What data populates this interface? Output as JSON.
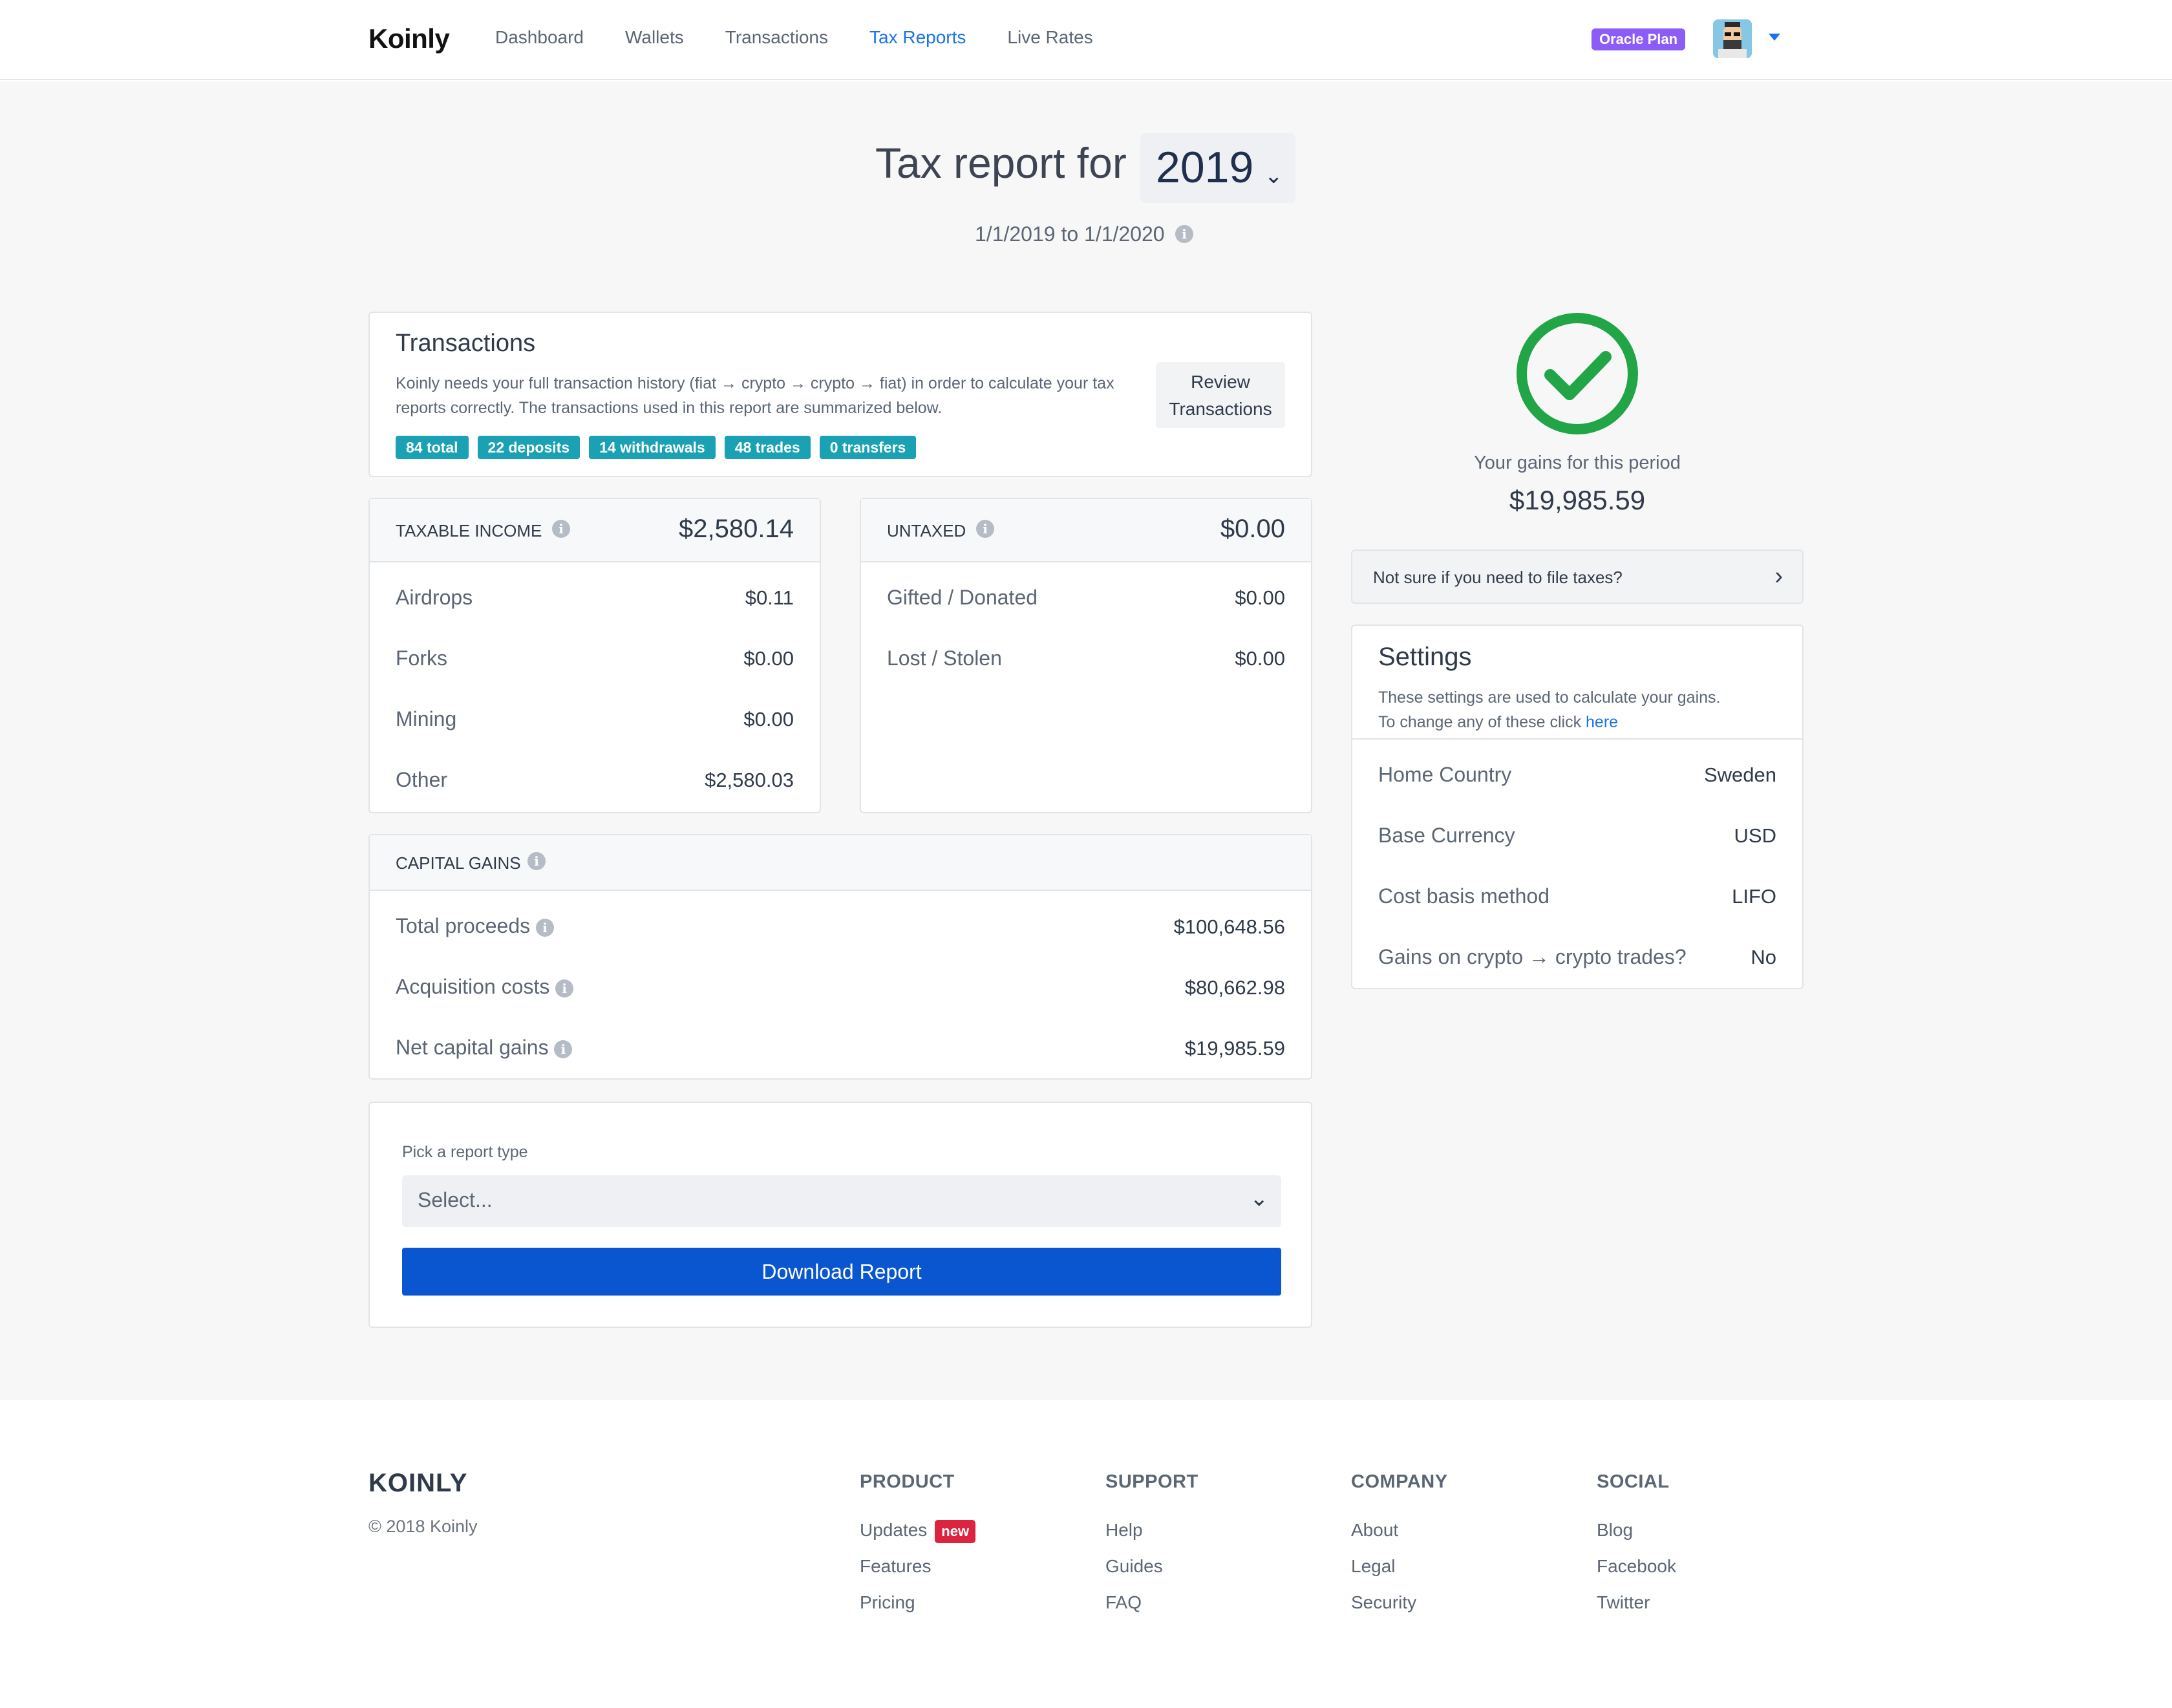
{
  "header": {
    "logo": "Koinly",
    "nav": [
      {
        "label": "Dashboard"
      },
      {
        "label": "Wallets"
      },
      {
        "label": "Transactions"
      },
      {
        "label": "Tax Reports"
      },
      {
        "label": "Live Rates"
      }
    ],
    "active_nav": "Tax Reports",
    "plan_badge": "Oracle Plan"
  },
  "title": {
    "prefix": "Tax report for",
    "year": "2019",
    "period": "1/1/2019 to 1/1/2020"
  },
  "transactions": {
    "title": "Transactions",
    "description": "Koinly needs your full transaction history (fiat → crypto → crypto → fiat) in order to calculate your tax reports correctly. The transactions used in this report are summarized below.",
    "review_button": "Review Transactions",
    "pills": [
      "84 total",
      "22 deposits",
      "14 withdrawals",
      "48 trades",
      "0 transfers"
    ]
  },
  "taxable_income": {
    "label": "TAXABLE INCOME",
    "amount": "$2,580.14",
    "rows": [
      {
        "label": "Airdrops",
        "value": "$0.11"
      },
      {
        "label": "Forks",
        "value": "$0.00"
      },
      {
        "label": "Mining",
        "value": "$0.00"
      },
      {
        "label": "Other",
        "value": "$2,580.03"
      }
    ]
  },
  "untaxed": {
    "label": "UNTAXED",
    "amount": "$0.00",
    "rows": [
      {
        "label": "Gifted / Donated",
        "value": "$0.00"
      },
      {
        "label": "Lost / Stolen",
        "value": "$0.00"
      }
    ]
  },
  "capital_gains": {
    "label": "CAPITAL GAINS",
    "rows": [
      {
        "label": "Total proceeds",
        "value": "$100,648.56"
      },
      {
        "label": "Acquisition costs",
        "value": "$80,662.98"
      },
      {
        "label": "Net capital gains",
        "value": "$19,985.59"
      }
    ]
  },
  "report": {
    "pick_label": "Pick a report type",
    "select_placeholder": "Select...",
    "download_button": "Download Report"
  },
  "summary": {
    "gains_label": "Your gains for this period",
    "gains_value": "$19,985.59",
    "file_taxes_link": "Not sure if you need to file taxes?"
  },
  "settings": {
    "title": "Settings",
    "desc_line1": "These settings are used to calculate your gains.",
    "desc_line2": "To change any of these click",
    "desc_link": "here",
    "rows": [
      {
        "label": "Home Country",
        "value": "Sweden"
      },
      {
        "label": "Base Currency",
        "value": "USD"
      },
      {
        "label": "Cost basis method",
        "value": "LIFO"
      },
      {
        "label": "Gains on crypto → crypto trades?",
        "value": "No"
      }
    ]
  },
  "footer": {
    "logo": "KOINLY",
    "copyright": "© 2018 Koinly",
    "columns": [
      {
        "title": "PRODUCT",
        "links": [
          "Updates",
          "Features",
          "Pricing"
        ]
      },
      {
        "title": "SUPPORT",
        "links": [
          "Help",
          "Guides",
          "FAQ"
        ]
      },
      {
        "title": "COMPANY",
        "links": [
          "About",
          "Legal",
          "Security"
        ]
      },
      {
        "title": "SOCIAL",
        "links": [
          "Blog",
          "Facebook",
          "Twitter"
        ]
      }
    ],
    "new_badge": "new"
  },
  "colors": {
    "accent": "#1a73e8",
    "plan_badge": "#8b5cf6",
    "pill": "#1aa1b3",
    "success": "#22a547",
    "download_button": "#0a56d0",
    "new_badge": "#dc2340"
  }
}
